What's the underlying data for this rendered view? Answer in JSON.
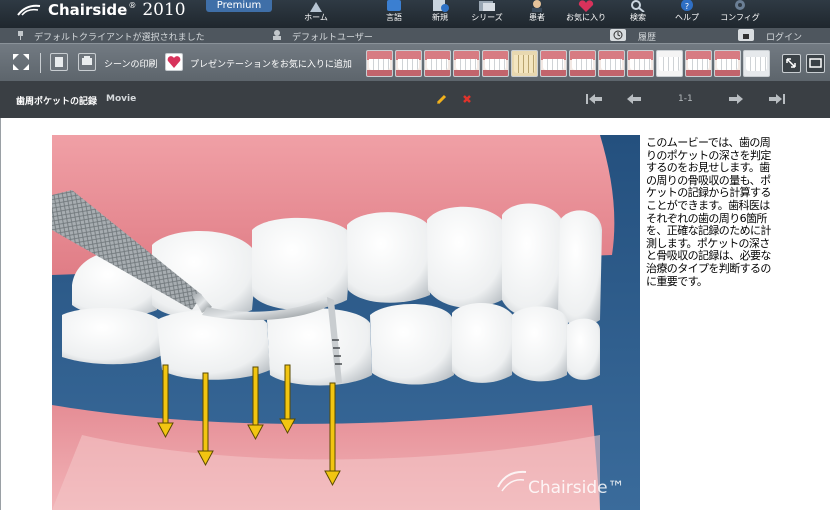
{
  "app": {
    "brand_name": "Chairside",
    "brand_mark": "®",
    "brand_year": "2010",
    "edition": "Premium",
    "watermark": "Chairside™"
  },
  "nav": [
    {
      "label": "ホーム",
      "icon": "home-icon"
    },
    {
      "label": "言語",
      "icon": "language-icon"
    },
    {
      "label": "新規",
      "icon": "new-icon"
    },
    {
      "label": "シリーズ",
      "icon": "series-icon"
    },
    {
      "label": "患者",
      "icon": "patient-icon"
    },
    {
      "label": "お気に入り",
      "icon": "favorites-icon"
    },
    {
      "label": "検索",
      "icon": "search-icon"
    },
    {
      "label": "ヘルプ",
      "icon": "help-icon"
    },
    {
      "label": "コンフィグ",
      "icon": "config-icon"
    }
  ],
  "status": {
    "client": "デフォルトクライアントが選択されました",
    "user": "デフォルトユーザー",
    "history": "履歴",
    "login": "ログイン"
  },
  "toolbar": {
    "print_scene": "シーンの印刷",
    "add_favorite": "プレゼンテーションをお気に入りに追加"
  },
  "movie": {
    "title": "歯周ポケットの記録",
    "type": "Movie",
    "page": "1-1"
  },
  "description": "このムービーでは、歯の周りのポケットの深さを判定するのをお見せします。歯の周りの骨吸収の量も、ポケットの記録から計算することができます。歯科医はそれぞれの歯の周り6箇所を、正確な記録のために計測します。ポケットの深さと骨吸収の記録は、必要な治療のタイプを判断するのに重要です。",
  "colors": {
    "accent": "#3f6fa8",
    "arrow": "#f2c511",
    "edit_pencil": "#f2b11c",
    "delete_x": "#e0332b"
  }
}
